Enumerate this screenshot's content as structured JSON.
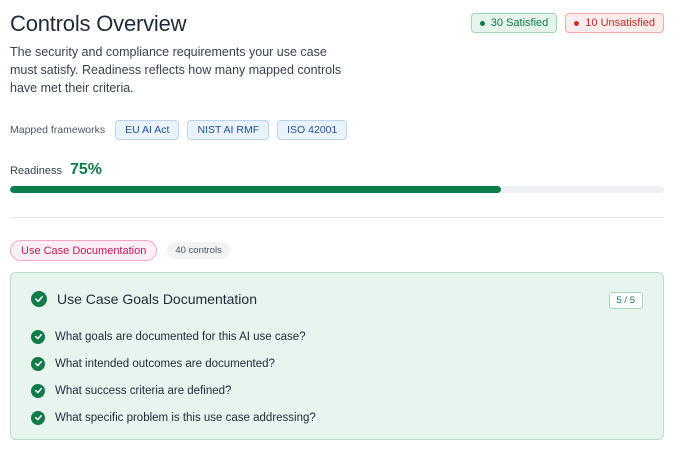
{
  "header": {
    "title": "Controls Overview",
    "satisfied_label": "30 Satisfied",
    "unsatisfied_label": "10 Unsatisfied"
  },
  "description": "The security and compliance requirements your use case must satisfy. Readiness reflects how many mapped controls have met their criteria.",
  "frameworks": {
    "label": "Mapped frameworks",
    "items": [
      "EU AI Act",
      "NIST AI RMF",
      "ISO 42001"
    ]
  },
  "readiness": {
    "label": "Readiness",
    "value_text": "75%",
    "percent": 75
  },
  "category": {
    "label": "Use Case Documentation",
    "count_label": "40 controls"
  },
  "group": {
    "title": "Use Case Goals Documentation",
    "count_label": "5 / 5",
    "questions": [
      "What goals are documented for this AI use case?",
      "What intended outcomes are documented?",
      "What success criteria are defined?",
      "What specific problem is this use case addressing?"
    ]
  },
  "colors": {
    "accent_green": "#0f7a4a",
    "progress_fill": "#0b7d4f",
    "danger_red": "#d32f2f",
    "category_pink": "#c2185b",
    "framework_blue": "#1e4f9c"
  }
}
